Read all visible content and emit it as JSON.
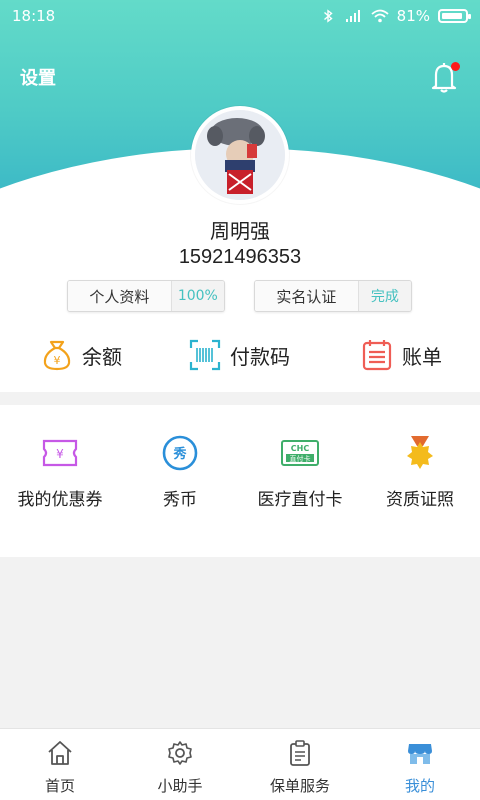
{
  "status_bar": {
    "time": "18:18",
    "battery": "81%"
  },
  "header": {
    "settings_label": "设置"
  },
  "profile": {
    "name": "周明强",
    "phone": "15921496353",
    "profile_pill": {
      "label": "个人资料",
      "value": "100%"
    },
    "verify_pill": {
      "label": "实名认证",
      "value": "完成"
    }
  },
  "quick_actions": [
    {
      "label": "余额",
      "icon": "money-bag-icon"
    },
    {
      "label": "付款码",
      "icon": "barcode-scan-icon"
    },
    {
      "label": "账单",
      "icon": "bill-icon"
    }
  ],
  "services": [
    {
      "label": "我的优惠券",
      "icon": "coupon-icon"
    },
    {
      "label": "秀币",
      "icon": "coin-icon",
      "badge": "秀"
    },
    {
      "label": "医疗直付卡",
      "icon": "card-icon",
      "card_top": "CHC",
      "card_bottom": "直付卡"
    },
    {
      "label": "资质证照",
      "icon": "medal-icon"
    }
  ],
  "tabs": [
    {
      "label": "首页",
      "icon": "home-icon"
    },
    {
      "label": "小助手",
      "icon": "gear-icon"
    },
    {
      "label": "保单服务",
      "icon": "clipboard-icon"
    },
    {
      "label": "我的",
      "icon": "store-icon",
      "active": true
    }
  ],
  "colors": {
    "accent": "#4fcbc6",
    "tab_active": "#3a8fd8",
    "notify_dot": "#ff1a1a"
  }
}
